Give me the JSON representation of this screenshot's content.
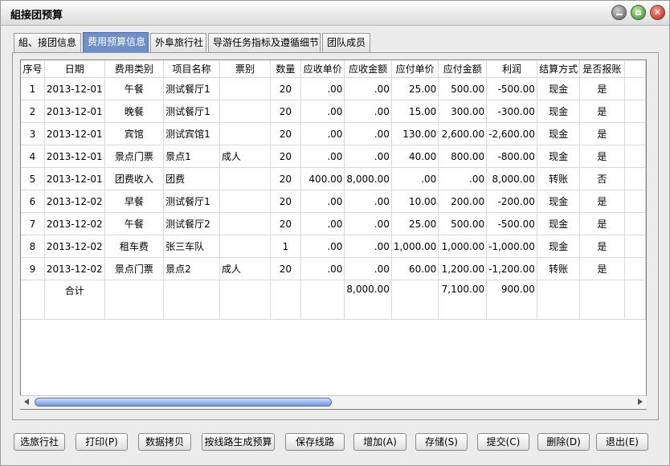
{
  "window": {
    "title": "組接团预算"
  },
  "tabs": [
    {
      "label": "組、接团信息"
    },
    {
      "label": "费用预算信息",
      "active": true
    },
    {
      "label": "外阜旅行社"
    },
    {
      "label": "导游任务指标及遵循细节"
    },
    {
      "label": "团队成员"
    }
  ],
  "table": {
    "headers": [
      "序号",
      "日期",
      "费用类别",
      "项目名称",
      "票别",
      "数量",
      "应收单价",
      "应收金额",
      "应付单价",
      "应付金额",
      "利润",
      "结算方式",
      "是否报账"
    ],
    "rows": [
      [
        "1",
        "2013-12-01",
        "午餐",
        "测试餐厅1",
        "",
        "20",
        ".00",
        ".00",
        "25.00",
        "500.00",
        "-500.00",
        "现金",
        "是"
      ],
      [
        "2",
        "2013-12-01",
        "晚餐",
        "测试餐厅1",
        "",
        "20",
        ".00",
        ".00",
        "15.00",
        "300.00",
        "-300.00",
        "现金",
        "是"
      ],
      [
        "3",
        "2013-12-01",
        "宾馆",
        "测试宾馆1",
        "",
        "20",
        ".00",
        ".00",
        "130.00",
        "2,600.00",
        "-2,600.00",
        "现金",
        "是"
      ],
      [
        "4",
        "2013-12-01",
        "景点门票",
        "景点1",
        "成人",
        "20",
        ".00",
        ".00",
        "40.00",
        "800.00",
        "-800.00",
        "现金",
        "是"
      ],
      [
        "5",
        "2013-12-01",
        "团费收入",
        "团费",
        "",
        "20",
        "400.00",
        "8,000.00",
        ".00",
        ".00",
        "8,000.00",
        "转账",
        "否"
      ],
      [
        "6",
        "2013-12-02",
        "早餐",
        "测试餐厅1",
        "",
        "20",
        ".00",
        ".00",
        "10.00",
        "200.00",
        "-200.00",
        "现金",
        "是"
      ],
      [
        "7",
        "2013-12-02",
        "午餐",
        "测试餐厅2",
        "",
        "20",
        ".00",
        ".00",
        "25.00",
        "500.00",
        "-500.00",
        "现金",
        "是"
      ],
      [
        "8",
        "2013-12-02",
        "租车费",
        "张三车队",
        "",
        "1",
        ".00",
        ".00",
        "1,000.00",
        "1,000.00",
        "-1,000.00",
        "现金",
        "是"
      ],
      [
        "9",
        "2013-12-02",
        "景点门票",
        "景点2",
        "成人",
        "20",
        ".00",
        ".00",
        "60.00",
        "1,200.00",
        "-1,200.00",
        "转账",
        "是"
      ]
    ],
    "total": [
      "",
      "合计",
      "",
      "",
      "",
      "",
      "",
      "8,000.00",
      "",
      "7,100.00",
      "900.00",
      "",
      ""
    ]
  },
  "buttons": [
    {
      "label": "选旅行社"
    },
    {
      "label": "打印(P)"
    },
    {
      "label": "数据拷贝"
    },
    {
      "label": "按线路生成预算"
    },
    {
      "label": "保存线路"
    },
    {
      "label": "增加(A)"
    },
    {
      "label": "存储(S)"
    },
    {
      "label": "提交(C)"
    },
    {
      "label": "删除(D)"
    },
    {
      "label": "退出(E)"
    }
  ]
}
